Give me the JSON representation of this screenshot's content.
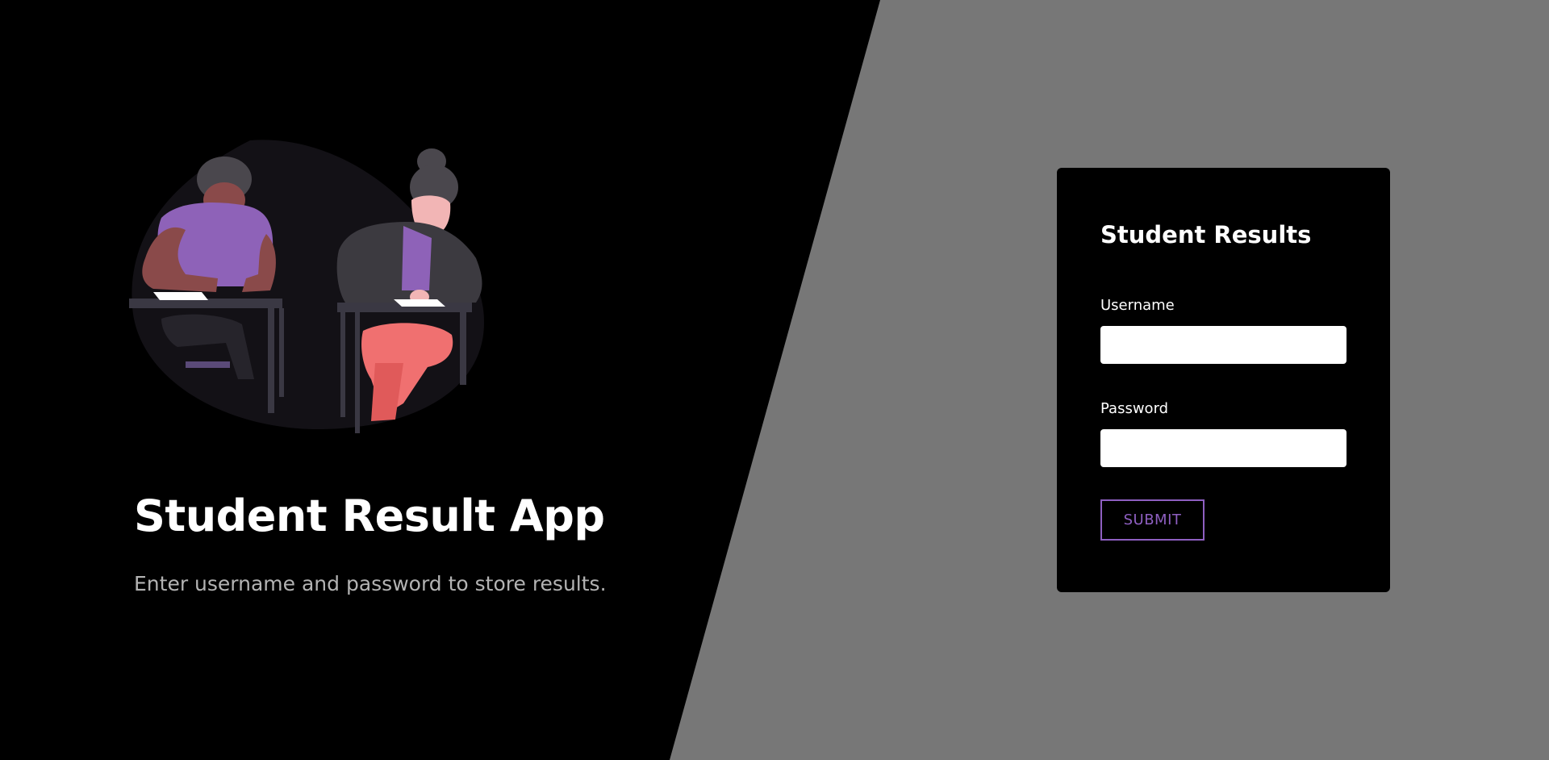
{
  "hero": {
    "title": "Student Result App",
    "subtitle": "Enter username and password to store results."
  },
  "login": {
    "title": "Student Results",
    "username_label": "Username",
    "username_value": "",
    "password_label": "Password",
    "password_value": "",
    "submit_label": "SUBMIT"
  },
  "illustration": {
    "icon": "students-taking-exam-illustration"
  },
  "colors": {
    "page_background": "#777777",
    "left_panel": "#000000",
    "card_background": "#000000",
    "accent": "#8e5fc1",
    "subtitle_text": "#b3b3b3"
  }
}
